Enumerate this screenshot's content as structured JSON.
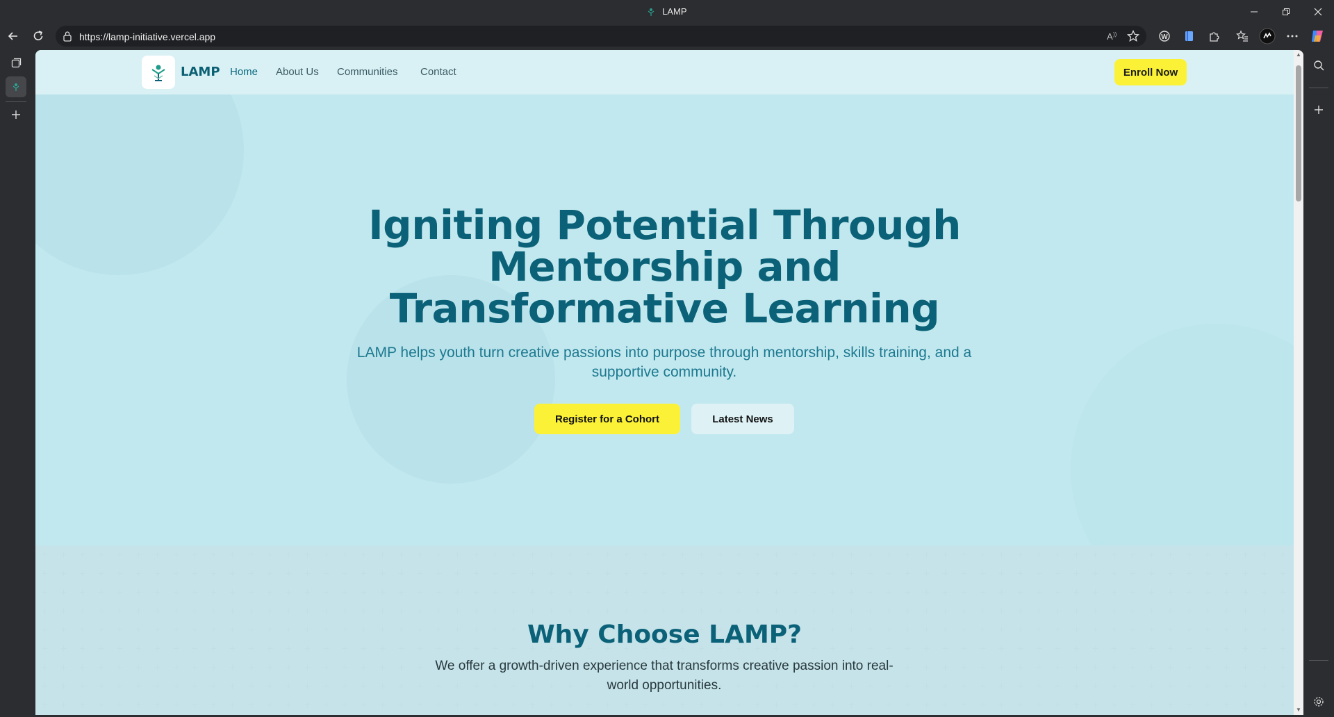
{
  "browser": {
    "tab_title": "LAMP",
    "url": "https://lamp-initiative.vercel.app"
  },
  "site": {
    "brand": "LAMP",
    "nav": [
      {
        "label": "Home",
        "active": true
      },
      {
        "label": "About Us",
        "active": false
      },
      {
        "label": "Communities",
        "active": false
      },
      {
        "label": "Contact",
        "active": false
      }
    ],
    "enroll_label": "Enroll Now"
  },
  "hero": {
    "title_line1": "Igniting Potential Through",
    "title_line2": "Mentorship and",
    "title_line3": "Transformative Learning",
    "subtitle": "LAMP helps youth turn creative passions into purpose through mentorship, skills training, and a supportive community.",
    "primary_button": "Register for a Cohort",
    "secondary_button": "Latest News"
  },
  "why": {
    "heading": "Why Choose LAMP?",
    "text": "We offer a growth-driven experience that transforms creative passion into real-world opportunities."
  },
  "colors": {
    "accent_yellow": "#fbf237",
    "brand_teal": "#0b6278",
    "hero_bg": "#c2e8ef",
    "header_bg": "#d9f1f5"
  }
}
